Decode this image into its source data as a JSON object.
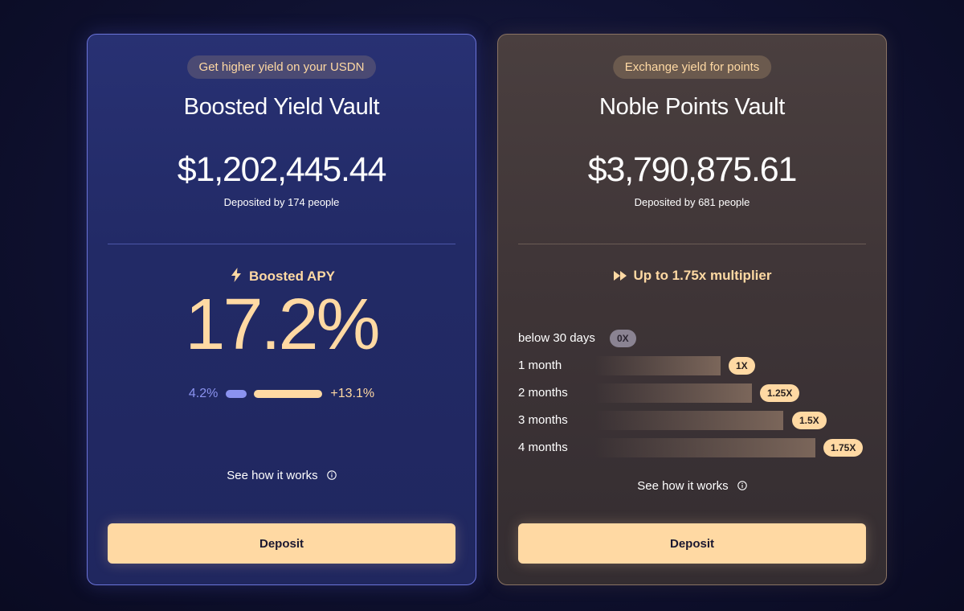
{
  "boosted_vault": {
    "tag": "Get higher yield on your USDN",
    "title": "Boosted Yield Vault",
    "amount": "$1,202,445.44",
    "depositors": "Deposited by 174 people",
    "feature_label": "Boosted APY",
    "feature_icon": "bolt-icon",
    "apy": "17.2%",
    "base_apy": "4.2%",
    "boost_apy": "+13.1%",
    "how_it_works": "See how it works",
    "deposit_label": "Deposit"
  },
  "points_vault": {
    "tag": "Exchange yield for points",
    "title": "Noble Points Vault",
    "amount": "$3,790,875.61",
    "depositors": "Deposited by 681 people",
    "feature_label": "Up to 1.75x multiplier",
    "feature_icon": "fast-forward-icon",
    "multipliers": [
      {
        "duration": "below 30 days",
        "multiplier": "0X",
        "value": 0
      },
      {
        "duration": "1 month",
        "multiplier": "1X",
        "value": 1
      },
      {
        "duration": "2 months",
        "multiplier": "1.25X",
        "value": 1.25
      },
      {
        "duration": "3 months",
        "multiplier": "1.5X",
        "value": 1.5
      },
      {
        "duration": "4 months",
        "multiplier": "1.75X",
        "value": 1.75
      }
    ],
    "how_it_works": "See how it works",
    "deposit_label": "Deposit"
  },
  "colors": {
    "accent": "#ffd9a3",
    "boost_blue": "#8b93f0",
    "background": "#0d0f2a"
  }
}
